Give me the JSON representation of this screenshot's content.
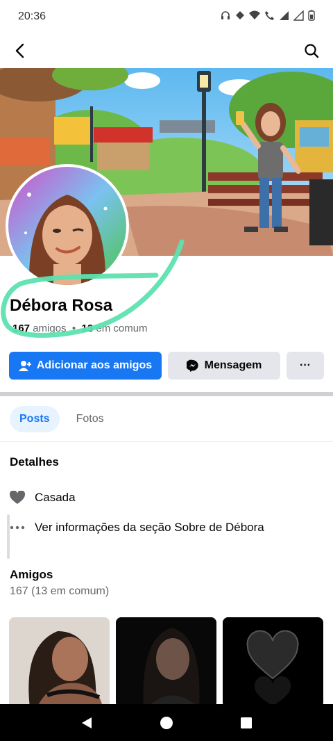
{
  "status_bar": {
    "time": "20:36"
  },
  "profile": {
    "name": "Débora Rosa",
    "friends_count": "167",
    "friends_word": "amigos",
    "separator": "•",
    "mutual_count": "13",
    "mutual_label": "em comum"
  },
  "actions": {
    "add_friend_label": "Adicionar aos amigos",
    "message_label": "Mensagem",
    "more_label": "···"
  },
  "tabs": [
    {
      "label": "Posts",
      "active": true
    },
    {
      "label": "Fotos",
      "active": false
    }
  ],
  "details": {
    "title": "Detalhes",
    "items": [
      {
        "icon": "heart-icon",
        "text": "Casada"
      },
      {
        "icon": "more-dots-icon",
        "text": "Ver informações da seção Sobre de Débora"
      }
    ]
  },
  "friends_section": {
    "title": "Amigos",
    "count_text": "167 (13 em comum)"
  },
  "colors": {
    "accent": "#1877f2",
    "annotation": "#5de2b0"
  }
}
